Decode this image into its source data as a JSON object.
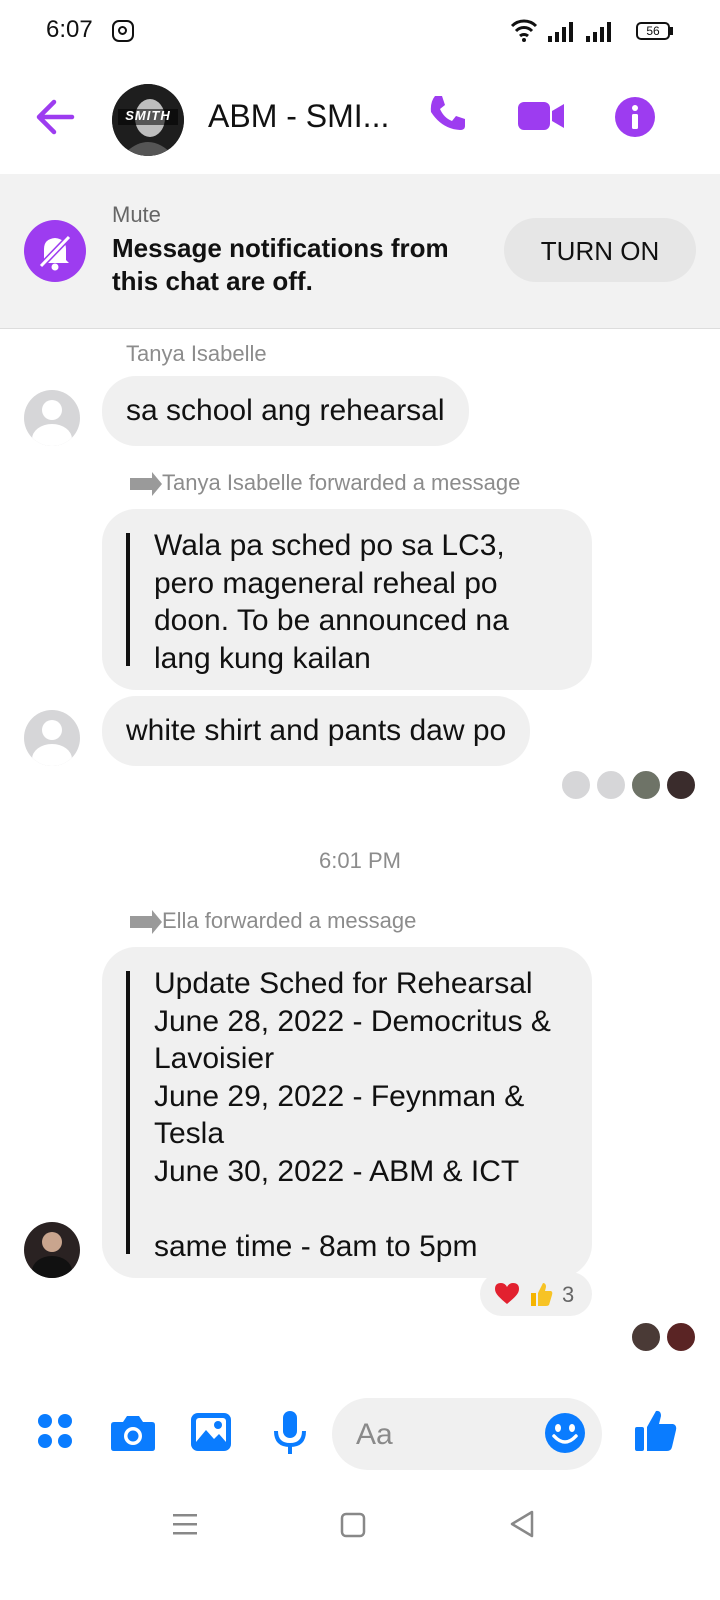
{
  "status_bar": {
    "time": "6:07",
    "battery": "56"
  },
  "header": {
    "title": "ABM - SMI...",
    "avatar_text": "SMITH"
  },
  "mute_banner": {
    "label": "Mute",
    "line1": "Message notifications from",
    "line2": "this chat are off.",
    "button": "TURN ON"
  },
  "messages": {
    "m1": {
      "sender": "Tanya Isabelle",
      "text": "sa school ang rehearsal"
    },
    "m2": {
      "forward_label": "Tanya Isabelle forwarded a message",
      "lines": [
        "Wala pa sched po sa LC3,",
        "pero mageneral reheal po",
        "doon. To be announced na",
        "lang kung kailan"
      ]
    },
    "m3": {
      "text": "white shirt and pants daw po"
    },
    "divider": "6:01 PM",
    "m4": {
      "forward_label": "Ella forwarded a message",
      "lines": [
        "Update Sched for Rehearsal",
        "June 28, 2022 - Democritus &",
        "Lavoisier",
        "June 29, 2022 - Feynman &",
        "Tesla",
        "June 30, 2022 - ABM & ICT",
        "",
        "same time - 8am to 5pm"
      ],
      "reactions": {
        "icons": [
          "heart-emoji",
          "thumbs-up-emoji"
        ],
        "count": "3"
      }
    }
  },
  "composer": {
    "placeholder": "Aa"
  },
  "colors": {
    "accent_purple": "#9d3cf0",
    "messenger_blue": "#0a7cff",
    "bubble_gray": "#f0f0f0"
  }
}
